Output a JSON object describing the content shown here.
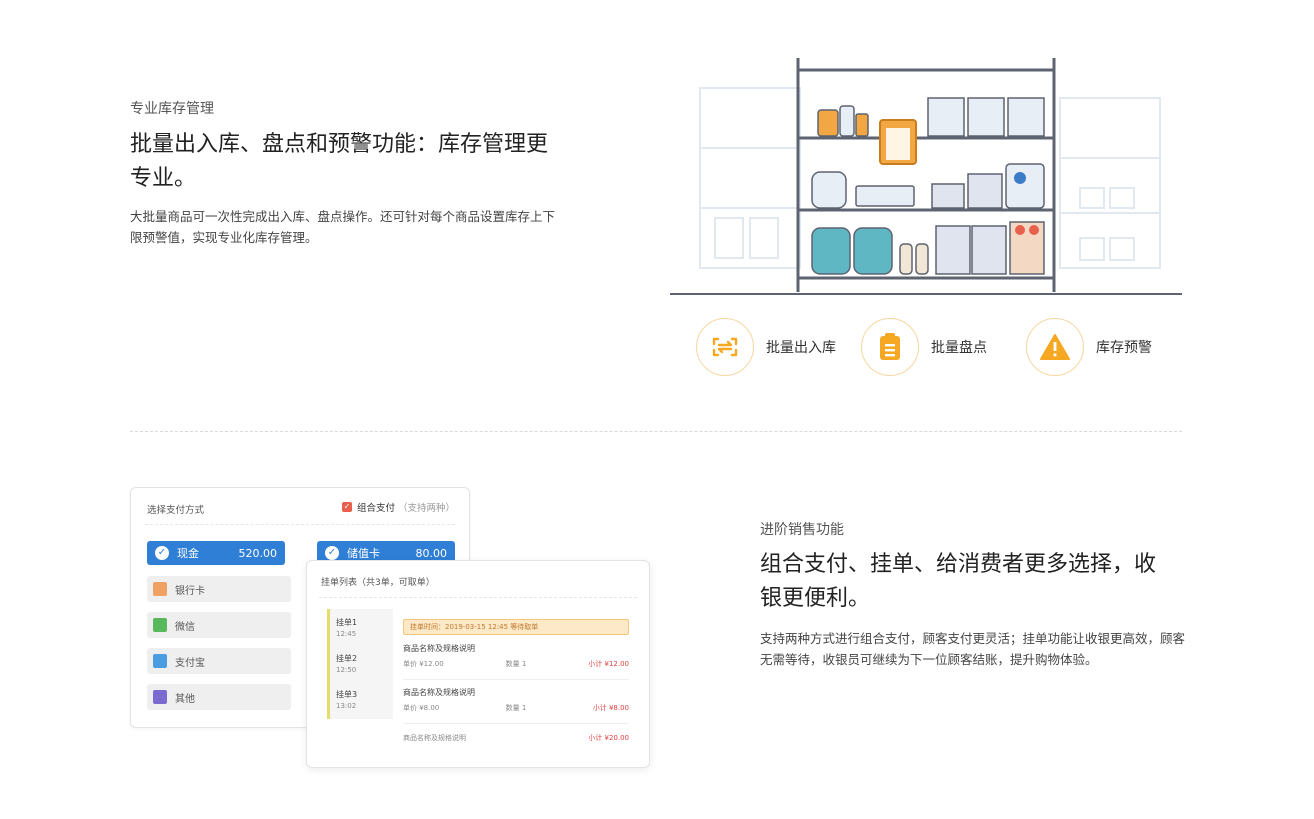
{
  "inventory": {
    "eyebrow": "专业库存管理",
    "title": "批量出入库、盘点和预警功能：库存管理更专业。",
    "description": "大批量商品可一次性完成出入库、盘点操作。还可针对每个商品设置库存上下限预警值，实现专业化库存管理。",
    "illustration_icon": "warehouse-shelf-illustration",
    "features": [
      {
        "label": "批量出入库",
        "icon": "swap-arrows-icon"
      },
      {
        "label": "批量盘点",
        "icon": "clipboard-list-icon"
      },
      {
        "label": "库存预警",
        "icon": "warning-triangle-icon"
      }
    ]
  },
  "sales": {
    "eyebrow": "进阶销售功能",
    "title": "组合支付、挂单、给消费者更多选择，收银更便利。",
    "description": "支持两种方式进行组合支付，顾客支付更灵活；挂单功能让收银更高效，顾客无需等待，收银员可继续为下一位顾客结账，提升购物体验。"
  },
  "payment_card": {
    "title": "选择支付方式",
    "combo_label": "组合支付",
    "combo_hint": "（支持两种）",
    "selected": [
      {
        "label": "现金",
        "amount": "520.00"
      },
      {
        "label": "储值卡",
        "amount": "80.00"
      }
    ],
    "options": [
      "银行卡",
      "微信",
      "支付宝",
      "其他"
    ]
  },
  "order_card": {
    "title": "挂单列表（共3单，可取单）",
    "side_items": [
      {
        "name": "挂单1",
        "sub": "12:45"
      },
      {
        "name": "挂单2",
        "sub": "12:50"
      },
      {
        "name": "挂单3",
        "sub": "13:02"
      }
    ],
    "alert": "挂单时间：2019-03-15 12:45 等待取单",
    "lines": [
      {
        "title": "商品名称及规格说明",
        "meta": [
          "单价 ¥12.00",
          "数量 1",
          "小计 ¥12.00"
        ]
      },
      {
        "title": "商品名称及规格说明",
        "meta": [
          "单价 ¥8.00",
          "数量 1",
          "小计 ¥8.00"
        ]
      },
      {
        "title": "商品名称及规格说明",
        "meta": [
          "",
          "",
          "小计 ¥20.00"
        ]
      }
    ]
  },
  "colors": {
    "accent_orange": "#f7a823",
    "pay_blue": "#2f7fd6",
    "alert_bg": "#fde9c8",
    "combo_red": "#e8604c"
  }
}
